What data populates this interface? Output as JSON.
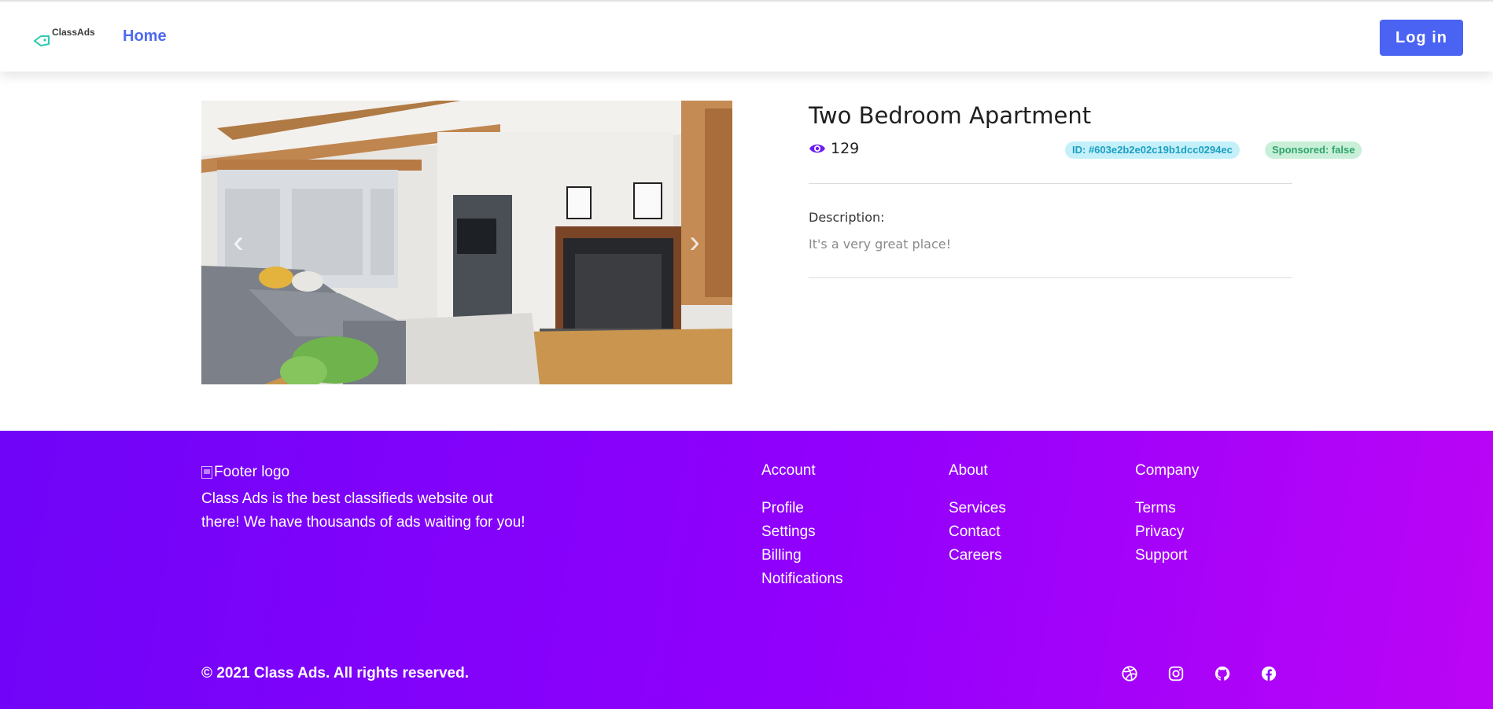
{
  "header": {
    "logo_text": "ClassAds",
    "nav_home": "Home",
    "login_label": "Log in"
  },
  "listing": {
    "title": "Two Bedroom Apartment",
    "views": "129",
    "id_badge": "ID: #603e2b2e02c19b1dcc0294ec",
    "sponsored_badge": "Sponsored: false",
    "description_label": "Description:",
    "description_text": "It's a very great place!",
    "carousel_prev": "‹",
    "carousel_next": "›"
  },
  "footer": {
    "logo_alt": "Footer logo",
    "about_text": "Class Ads is the best classifieds website out there! We have thousands of ads waiting for you!",
    "columns": [
      {
        "title": "Account",
        "links": [
          "Profile",
          "Settings",
          "Billing",
          "Notifications"
        ]
      },
      {
        "title": "About",
        "links": [
          "Services",
          "Contact",
          "Careers"
        ]
      },
      {
        "title": "Company",
        "links": [
          "Terms",
          "Privacy",
          "Support"
        ]
      }
    ],
    "copyright": "© 2021 Class Ads. All rights reserved.",
    "social_icons": [
      "dribbble-icon",
      "instagram-icon",
      "github-icon",
      "facebook-icon"
    ]
  },
  "colors": {
    "primary": "#4a63f2",
    "footer_start": "#6f04f8",
    "footer_end": "#bc05f6",
    "id_badge_bg": "#c4f0fa",
    "sponsored_badge_bg": "#c9efd9"
  }
}
